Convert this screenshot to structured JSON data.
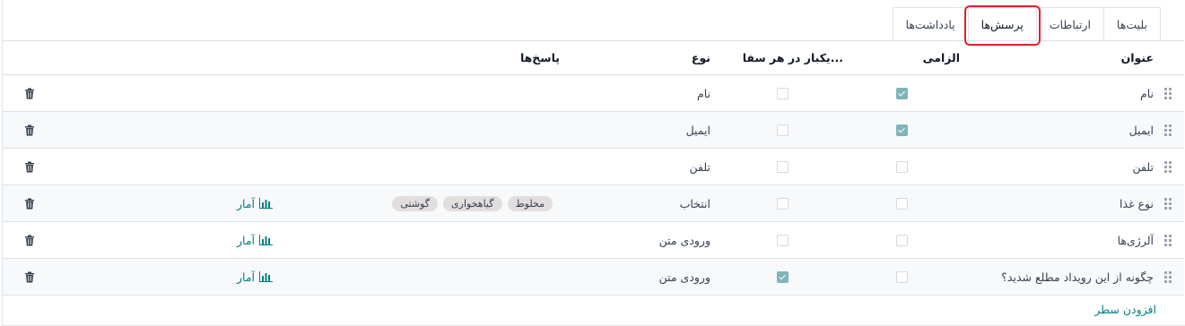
{
  "tabs": [
    "بلیت‌ها",
    "ارتباطات",
    "پرسش‌ها",
    "یادداشت‌ها"
  ],
  "active_tab": "پرسش‌ها",
  "columns": {
    "title": "عنوان",
    "mandatory": "الزامی",
    "once_per_order": "یکبار در هر سفا...",
    "type": "نوع",
    "answers": "پاسخ‌ها"
  },
  "rows": [
    {
      "title": "نام",
      "mandatory": true,
      "once": false,
      "type": "نام",
      "answers": [],
      "stats": ""
    },
    {
      "title": "ایمیل",
      "mandatory": true,
      "once": false,
      "type": "ایمیل",
      "answers": [],
      "stats": ""
    },
    {
      "title": "تلفن",
      "mandatory": false,
      "once": false,
      "type": "تلفن",
      "answers": [],
      "stats": ""
    },
    {
      "title": "نوع غذا",
      "mandatory": false,
      "once": false,
      "type": "انتخاب",
      "answers": [
        "مخلوط",
        "گیاهخواری",
        "گوشتی"
      ],
      "stats": "آمار"
    },
    {
      "title": "آلرژی‌ها",
      "mandatory": false,
      "once": false,
      "type": "ورودی متن",
      "answers": [],
      "stats": "آمار"
    },
    {
      "title": "چگونه از این رویداد مطلع شدید؟",
      "mandatory": false,
      "once": true,
      "type": "ورودی متن",
      "answers": [],
      "stats": "آمار"
    }
  ],
  "add_line": "افزودن سطر",
  "icons": {
    "drag": "drag-handle-icon",
    "delete": "trash-icon",
    "stats": "bar-chart-icon"
  },
  "colors": {
    "accent": "#017e84",
    "checkbox": "#7fb5b8",
    "highlight": "#e0202a",
    "tag": "#e2dede"
  }
}
